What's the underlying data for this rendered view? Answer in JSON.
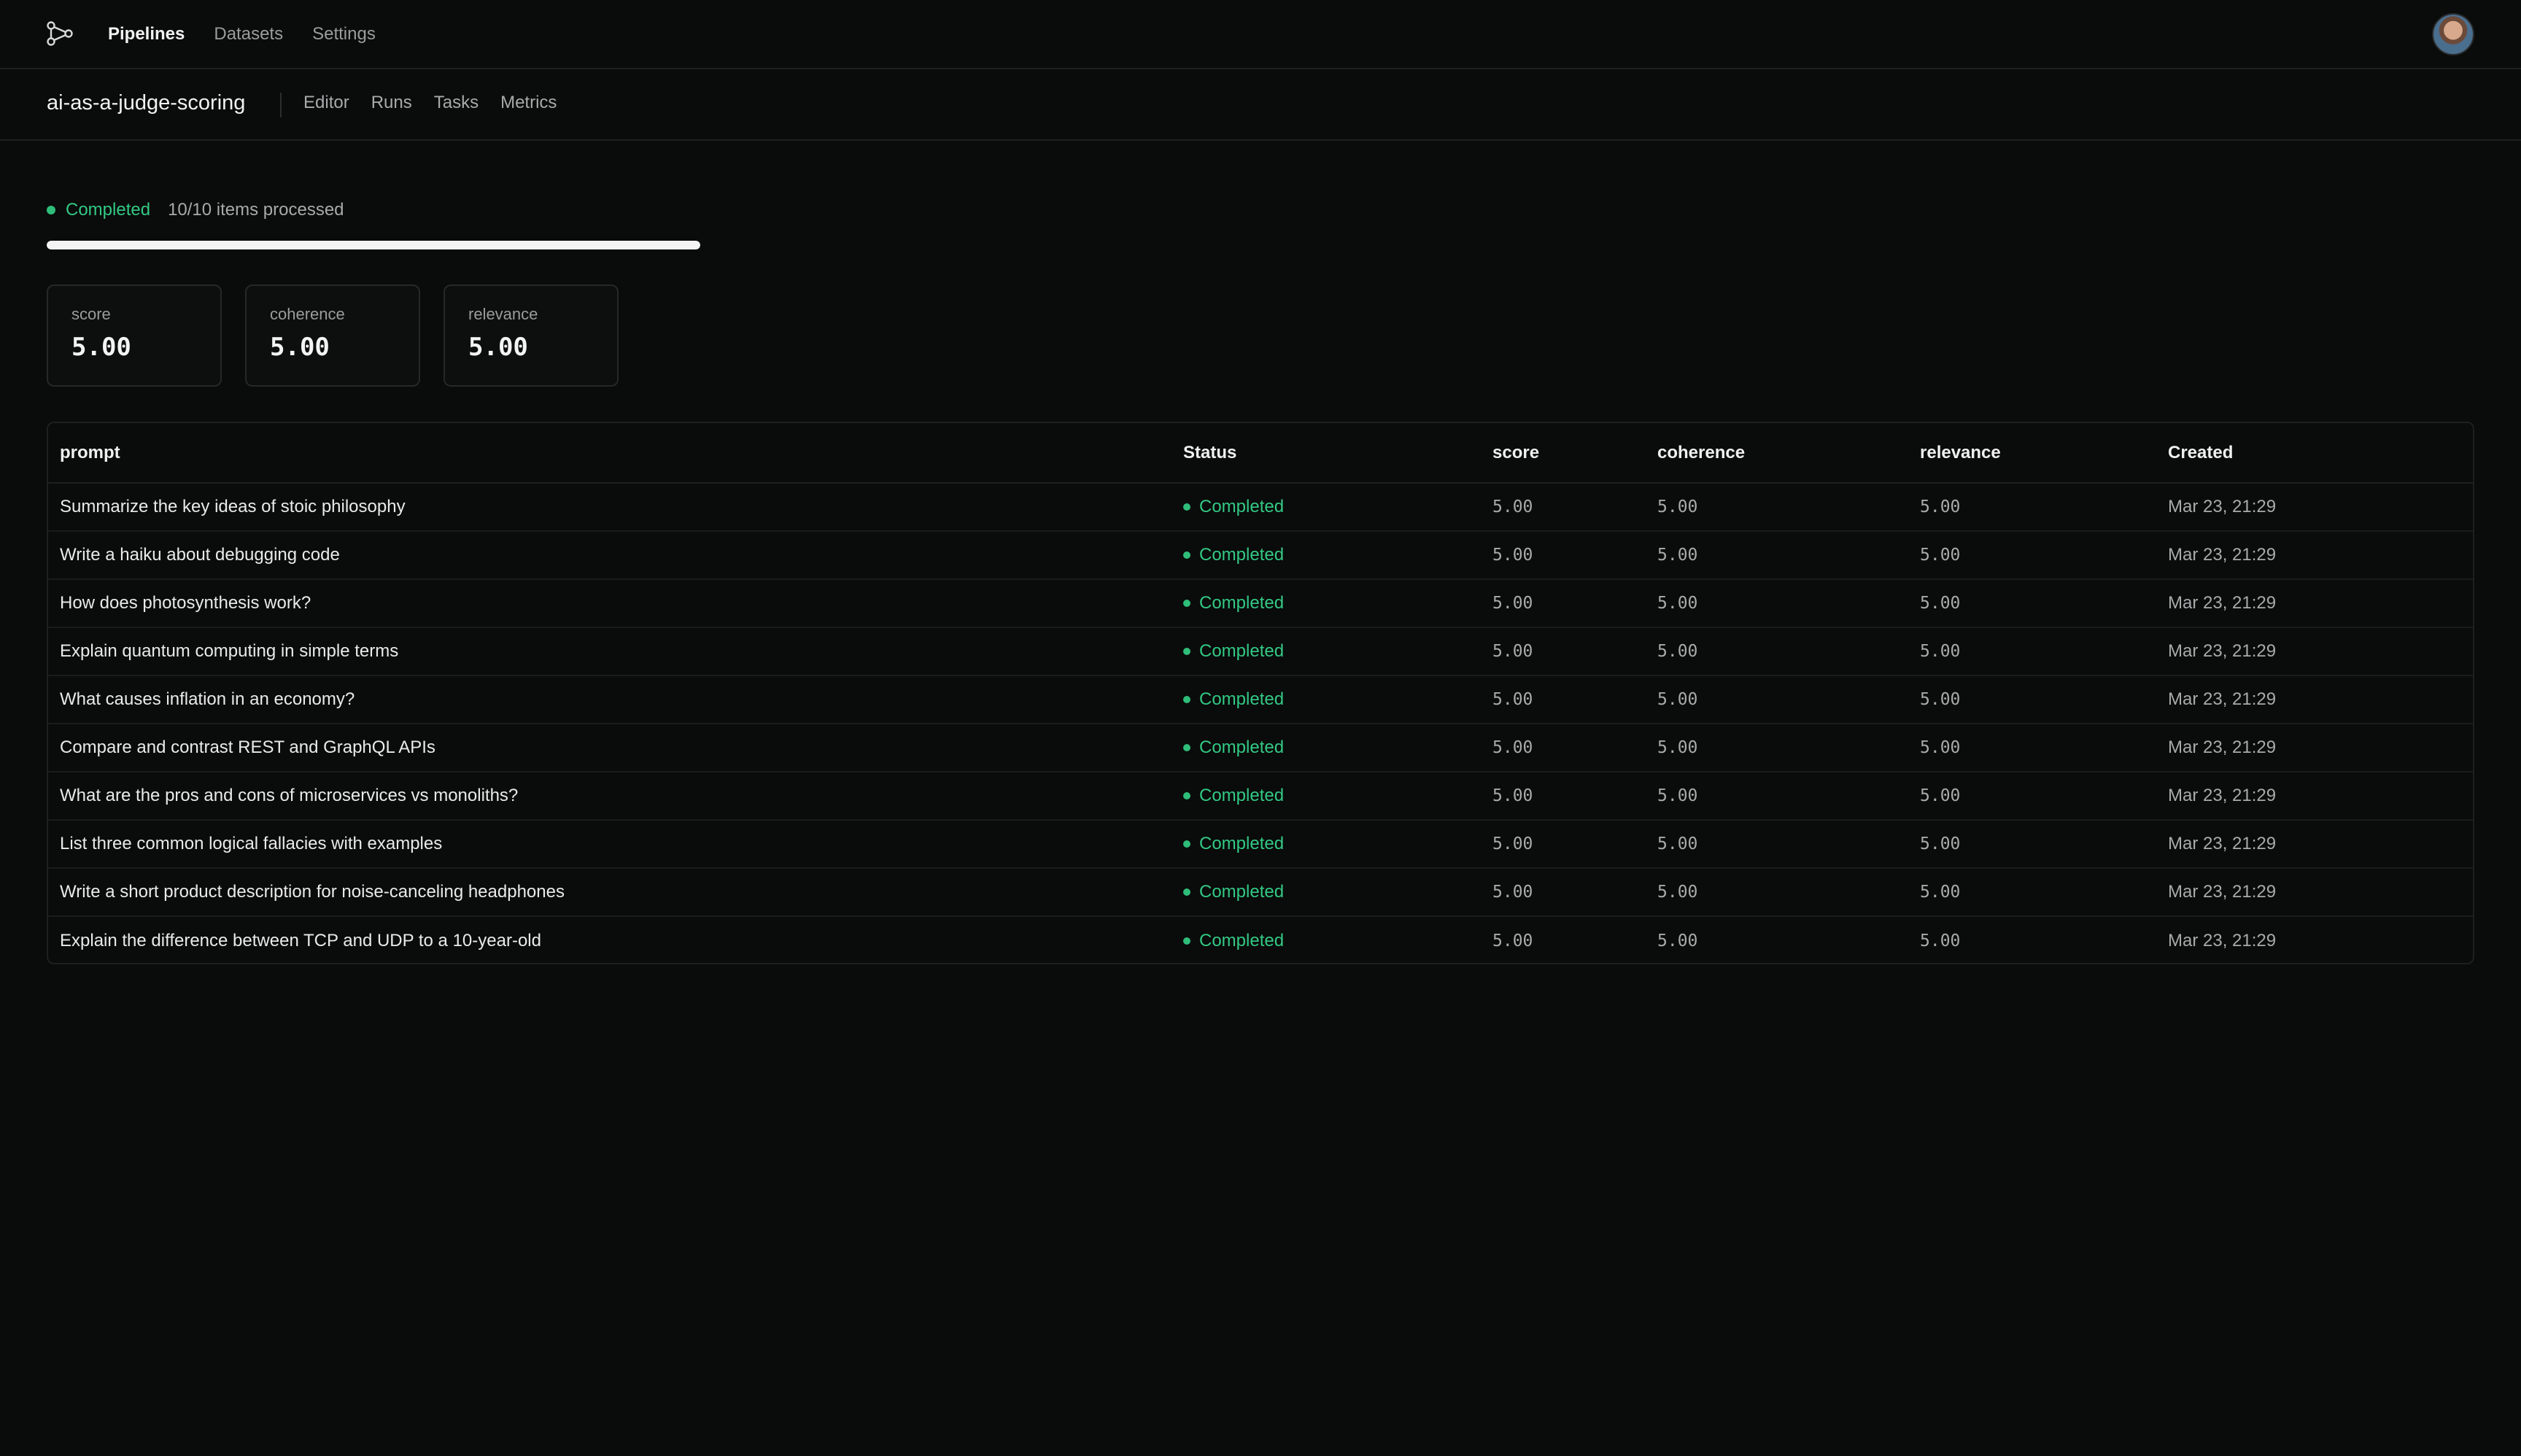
{
  "nav": {
    "items": [
      {
        "label": "Pipelines",
        "active": true
      },
      {
        "label": "Datasets",
        "active": false
      },
      {
        "label": "Settings",
        "active": false
      }
    ]
  },
  "pipeline": {
    "name": "ai-as-a-judge-scoring",
    "tabs": [
      "Editor",
      "Runs",
      "Tasks",
      "Metrics"
    ]
  },
  "run": {
    "status": "Completed",
    "processed_text": "10/10 items processed",
    "progress": 1.0
  },
  "metrics": [
    {
      "label": "score",
      "value": "5.00"
    },
    {
      "label": "coherence",
      "value": "5.00"
    },
    {
      "label": "relevance",
      "value": "5.00"
    }
  ],
  "table": {
    "columns": [
      "prompt",
      "Status",
      "score",
      "coherence",
      "relevance",
      "Created"
    ],
    "rows": [
      {
        "prompt": "Summarize the key ideas of stoic philosophy",
        "status": "Completed",
        "score": "5.00",
        "coherence": "5.00",
        "relevance": "5.00",
        "created": "Mar 23, 21:29"
      },
      {
        "prompt": "Write a haiku about debugging code",
        "status": "Completed",
        "score": "5.00",
        "coherence": "5.00",
        "relevance": "5.00",
        "created": "Mar 23, 21:29"
      },
      {
        "prompt": "How does photosynthesis work?",
        "status": "Completed",
        "score": "5.00",
        "coherence": "5.00",
        "relevance": "5.00",
        "created": "Mar 23, 21:29"
      },
      {
        "prompt": "Explain quantum computing in simple terms",
        "status": "Completed",
        "score": "5.00",
        "coherence": "5.00",
        "relevance": "5.00",
        "created": "Mar 23, 21:29"
      },
      {
        "prompt": "What causes inflation in an economy?",
        "status": "Completed",
        "score": "5.00",
        "coherence": "5.00",
        "relevance": "5.00",
        "created": "Mar 23, 21:29"
      },
      {
        "prompt": "Compare and contrast REST and GraphQL APIs",
        "status": "Completed",
        "score": "5.00",
        "coherence": "5.00",
        "relevance": "5.00",
        "created": "Mar 23, 21:29"
      },
      {
        "prompt": "What are the pros and cons of microservices vs monoliths?",
        "status": "Completed",
        "score": "5.00",
        "coherence": "5.00",
        "relevance": "5.00",
        "created": "Mar 23, 21:29"
      },
      {
        "prompt": "List three common logical fallacies with examples",
        "status": "Completed",
        "score": "5.00",
        "coherence": "5.00",
        "relevance": "5.00",
        "created": "Mar 23, 21:29"
      },
      {
        "prompt": "Write a short product description for noise-canceling headphones",
        "status": "Completed",
        "score": "5.00",
        "coherence": "5.00",
        "relevance": "5.00",
        "created": "Mar 23, 21:29"
      },
      {
        "prompt": "Explain the difference between TCP and UDP to a 10-year-old",
        "status": "Completed",
        "score": "5.00",
        "coherence": "5.00",
        "relevance": "5.00",
        "created": "Mar 23, 21:29"
      }
    ]
  },
  "colors": {
    "background": "#0a0b0b",
    "status_green": "#33c984",
    "border": "#1e2020"
  },
  "icons": {
    "logo": "pipeline-nodes-icon",
    "avatar": "user-avatar"
  }
}
